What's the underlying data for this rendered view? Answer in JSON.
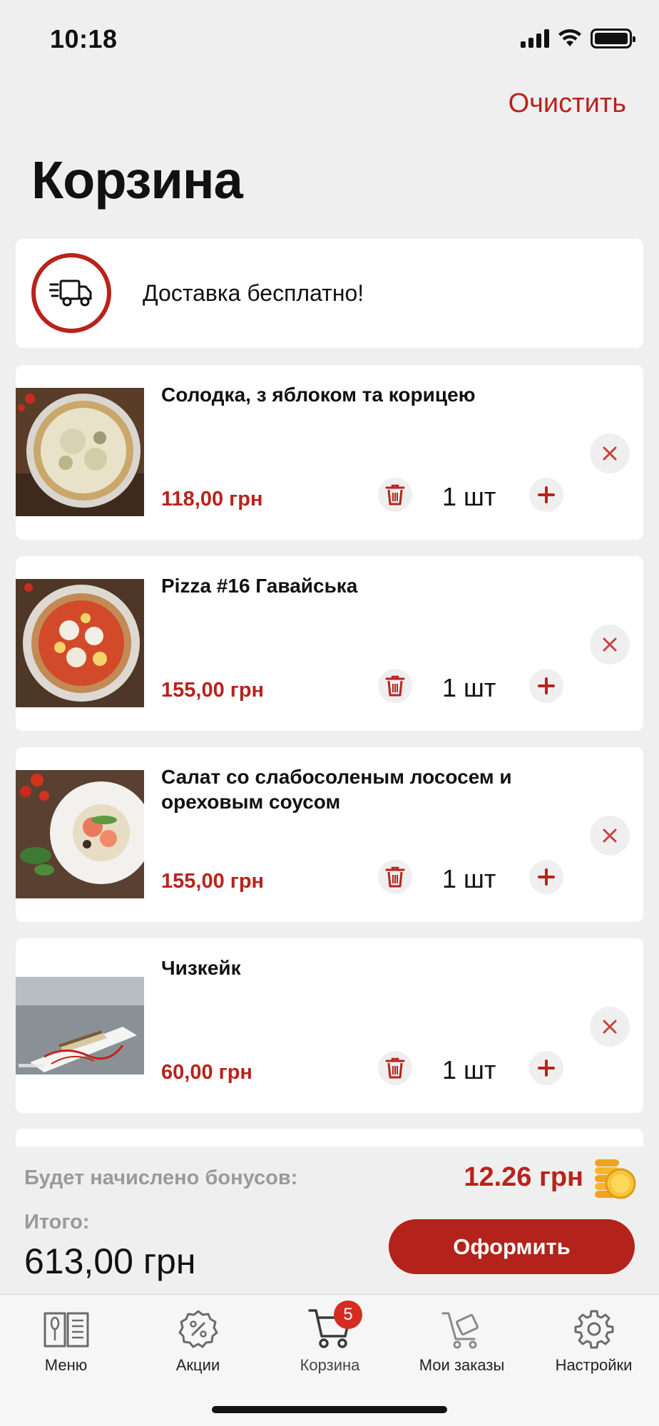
{
  "status_bar": {
    "time": "10:18"
  },
  "header": {
    "clear_label": "Очистить",
    "title": "Корзина"
  },
  "delivery": {
    "text": "Доставка бесплатно!",
    "icon": "delivery-truck-icon"
  },
  "items": [
    {
      "name": "Солодка, з яблоком та корицею",
      "price": "118,00 грн",
      "qty": "1 шт"
    },
    {
      "name": " Pizza #16 Гавайська",
      "price": "155,00 грн",
      "qty": "1 шт"
    },
    {
      "name": "Салат со слабосоленым лососем и ореховым соусом",
      "price": "155,00 грн",
      "qty": "1 шт"
    },
    {
      "name": "Чизкейк",
      "price": "60,00 грн",
      "qty": "1 шт"
    }
  ],
  "summary": {
    "bonus_label": "Будет начислено бонусов:",
    "bonus_value": "12.26 грн",
    "total_label": "Итого:",
    "total_value": "613,00 грн",
    "checkout_label": "Оформить"
  },
  "tabbar": {
    "tabs": [
      {
        "label": "Меню",
        "icon": "menu-book-icon"
      },
      {
        "label": "Акции",
        "icon": "discount-badge-icon"
      },
      {
        "label": "Корзина",
        "icon": "cart-icon",
        "badge": "5"
      },
      {
        "label": "Мои заказы",
        "icon": "orders-icon"
      },
      {
        "label": "Настройки",
        "icon": "gear-icon"
      }
    ]
  },
  "colors": {
    "accent": "#b8231b",
    "background": "#efefef",
    "card": "#ffffff",
    "muted": "#9a9a9a"
  }
}
